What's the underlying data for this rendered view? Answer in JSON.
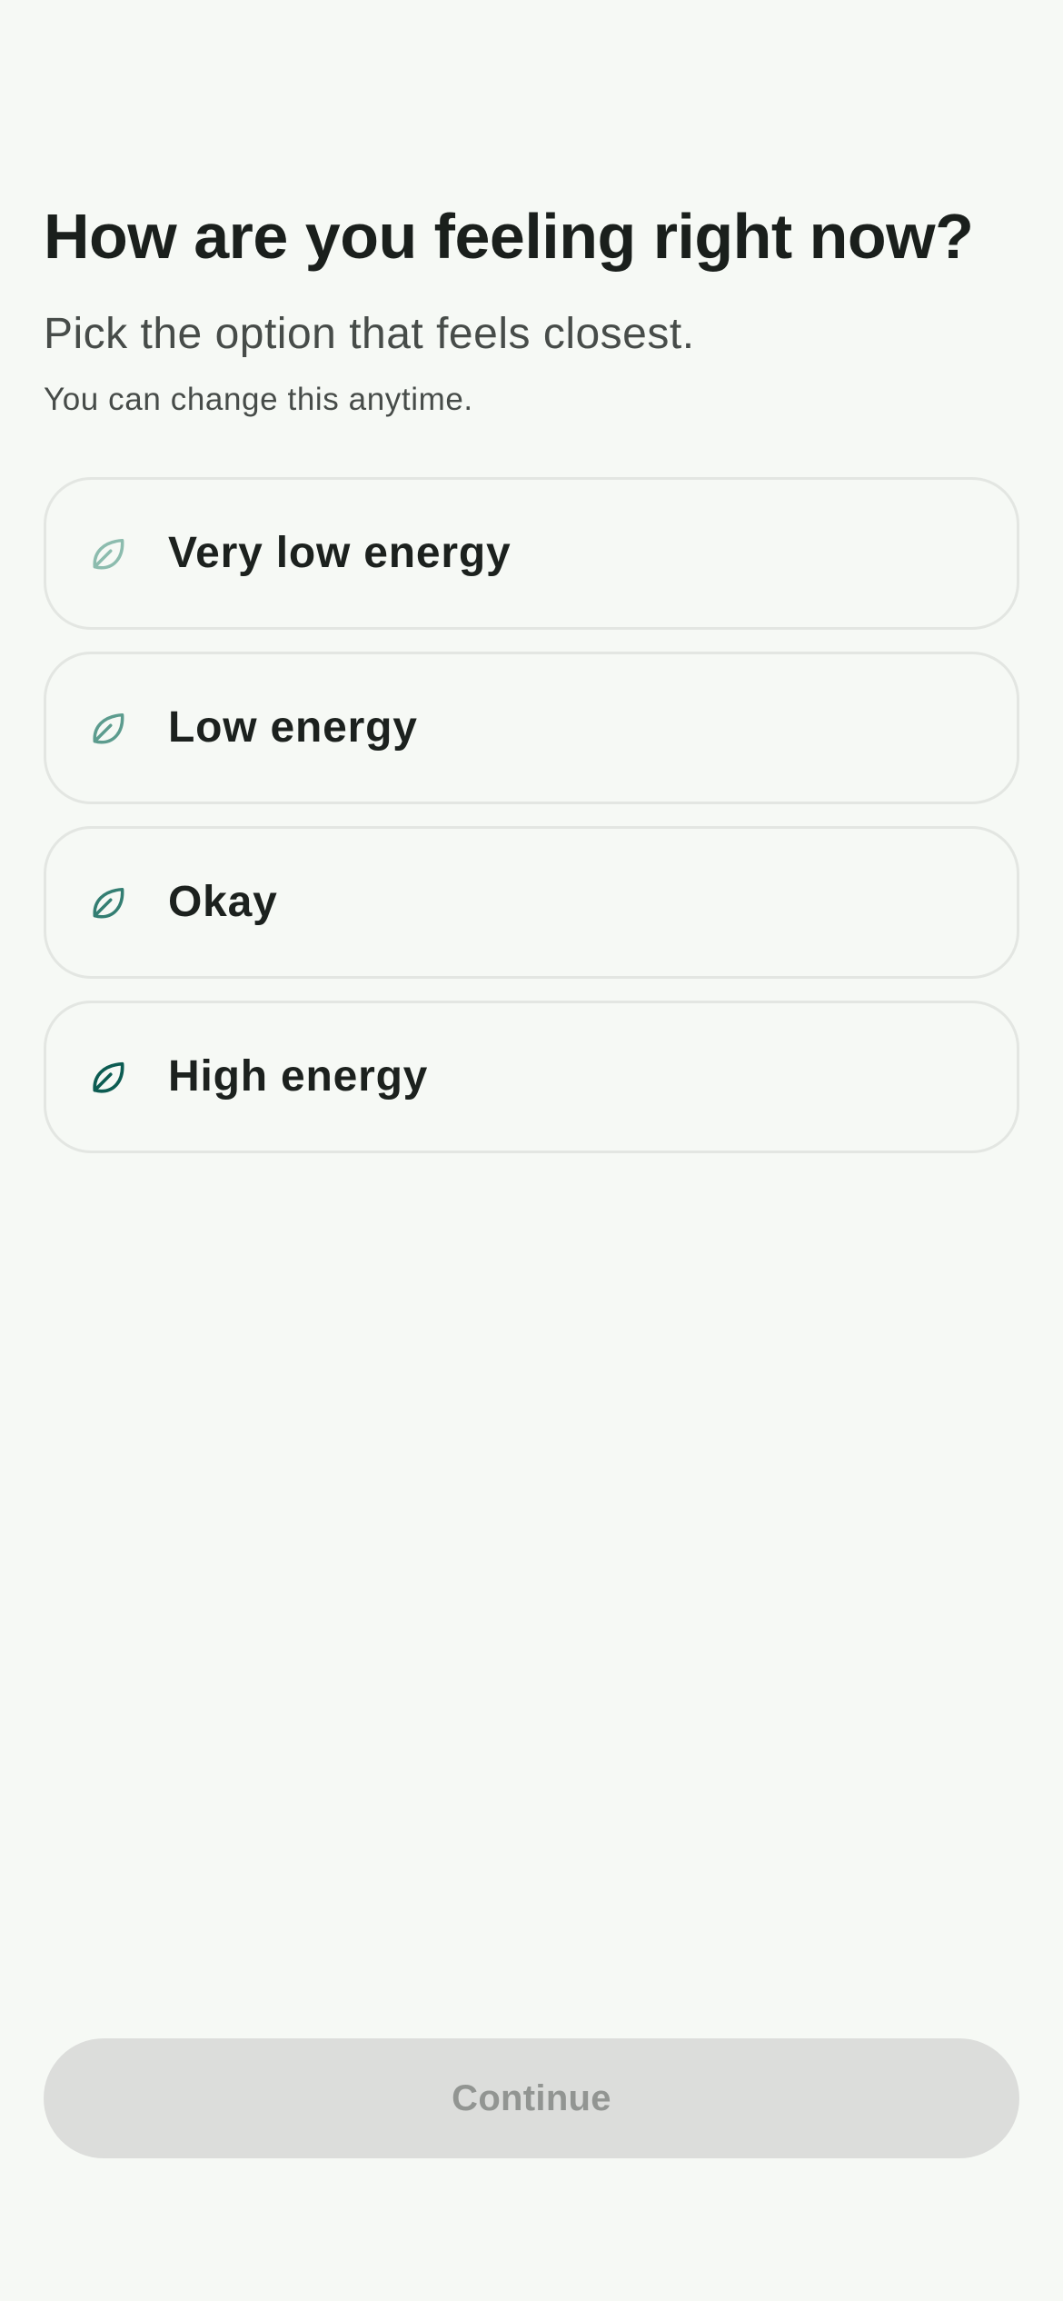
{
  "header": {
    "title": "How are you feeling right now?",
    "subtitle": "Pick the option that feels closest.",
    "hint": "You can change this anytime."
  },
  "options": [
    {
      "label": "Very low energy",
      "icon": "leaf-icon",
      "icon_color": "#8cbcae"
    },
    {
      "label": "Low energy",
      "icon": "leaf-icon",
      "icon_color": "#5c9c8e"
    },
    {
      "label": "Okay",
      "icon": "leaf-icon",
      "icon_color": "#337e72"
    },
    {
      "label": "High energy",
      "icon": "leaf-icon",
      "icon_color": "#0c5c52"
    }
  ],
  "footer": {
    "continue_label": "Continue",
    "continue_state": "disabled"
  },
  "colors": {
    "background": "#f6f9f5",
    "card_border": "#e3e6e2",
    "button_disabled_bg": "#dcdddb",
    "button_disabled_text": "#929592"
  }
}
